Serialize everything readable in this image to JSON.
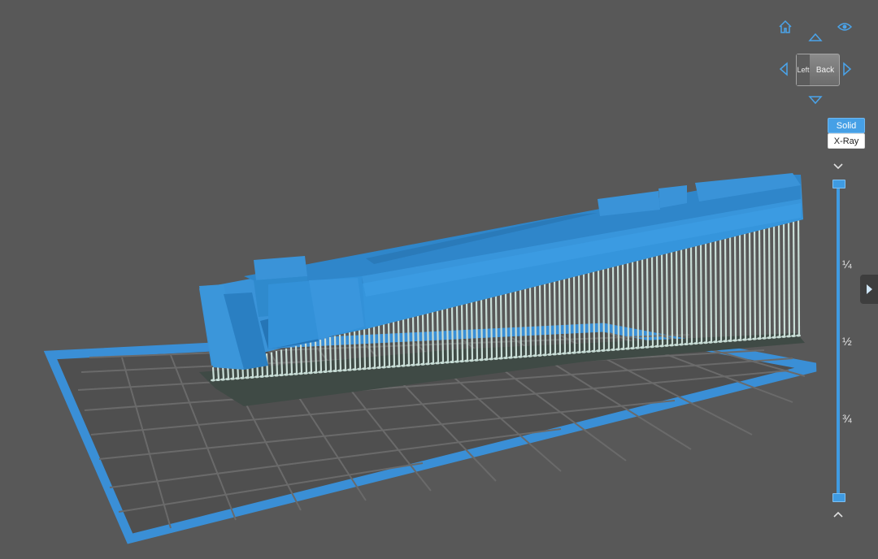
{
  "view_cube": {
    "left_face": "Left",
    "back_face": "Back"
  },
  "render_mode": {
    "solid_label": "Solid",
    "xray_label": "X-Ray",
    "selected": "Solid"
  },
  "layer_slider": {
    "ticks": [
      "¼",
      "½",
      "¾"
    ]
  },
  "icons": {
    "home": "home-icon",
    "eye": "eye-icon",
    "rotate": [
      "arrow-up-icon",
      "arrow-left-icon",
      "arrow-right-icon",
      "arrow-down-icon"
    ],
    "chevrons": [
      "chevron-down-icon",
      "chevron-up-icon"
    ],
    "panel": "triangle-right-icon"
  },
  "colors": {
    "accent": "#3f9be2",
    "model": "#3a93d8",
    "supports": "#c8ddd6",
    "background": "#585858"
  }
}
